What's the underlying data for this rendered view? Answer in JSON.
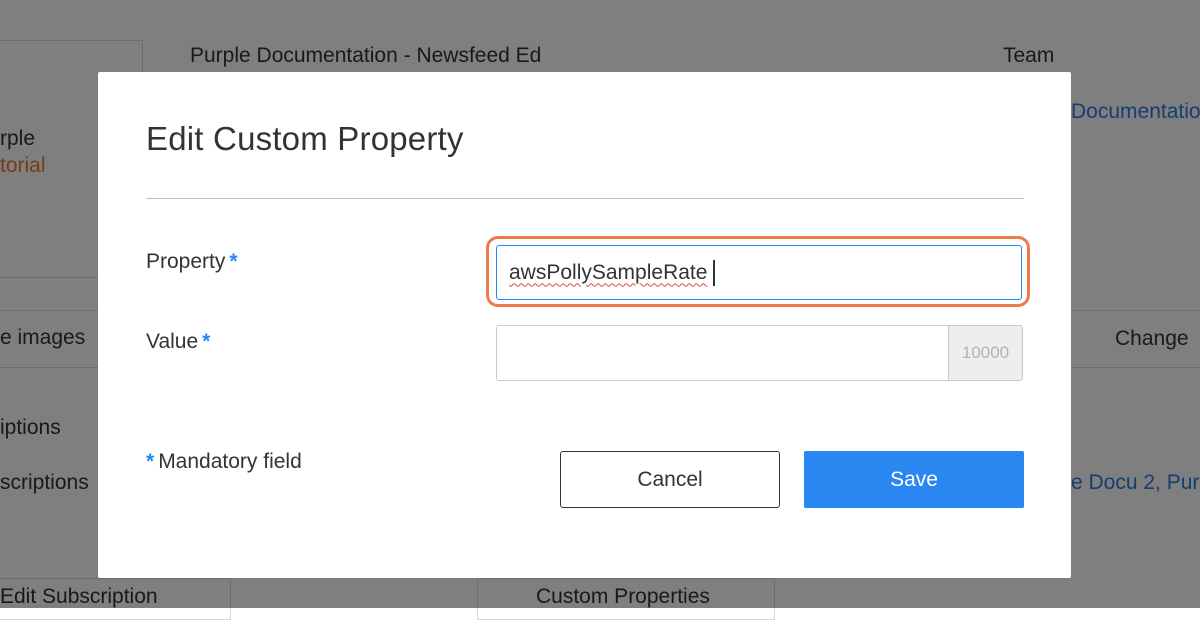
{
  "background": {
    "doc_title": "Purple Documentation - Newsfeed Ed",
    "team_label": "Team",
    "team_link": "Documentation",
    "left_title_1": "rple",
    "left_title_2": "torial",
    "images_label": "e images",
    "change_label": "Change",
    "subscriptions_heading": "iptions",
    "subscriptions_label": "scriptions",
    "docu_link": "e Docu 2, Pur",
    "edit_subscription": "Edit Subscription",
    "custom_properties": "Custom Properties"
  },
  "modal": {
    "title": "Edit Custom Property",
    "property_label": "Property",
    "property_value": "awsPollySampleRate",
    "value_label": "Value",
    "value_input": "",
    "value_addon": "10000",
    "required_mark": "*",
    "mandatory_note": "Mandatory field",
    "cancel_label": "Cancel",
    "save_label": "Save"
  },
  "colors": {
    "accent": "#2a86f0",
    "focus_highlight": "#ef7a4e"
  }
}
